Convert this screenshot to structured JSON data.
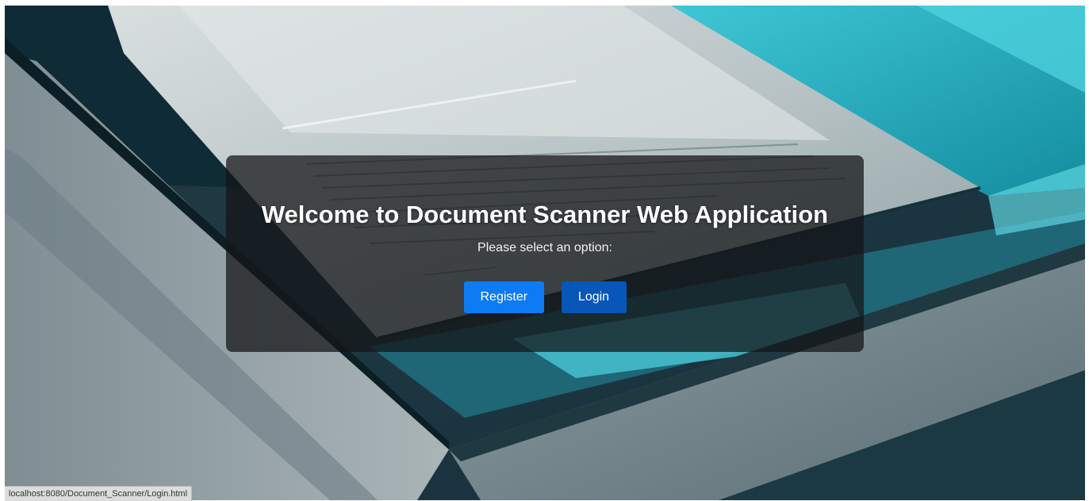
{
  "welcome": {
    "title": "Welcome to Document Scanner Web Application",
    "subtitle": "Please select an option:"
  },
  "actions": {
    "register_label": "Register",
    "login_label": "Login"
  },
  "status_bar": {
    "url": "localhost:8080/Document_Scanner/Login.html"
  },
  "colors": {
    "register_button": "#0d7cf4",
    "login_button": "#0857b8",
    "overlay": "#141618"
  }
}
